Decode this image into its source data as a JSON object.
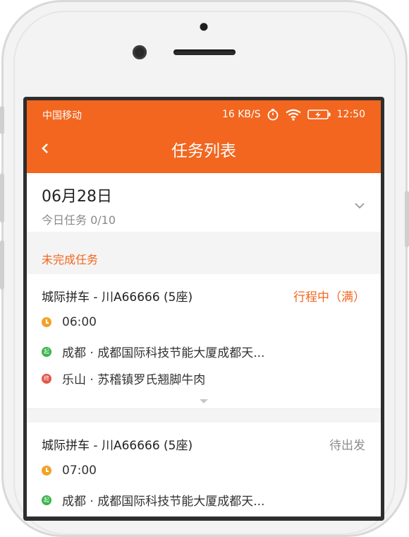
{
  "status_bar": {
    "carrier": "中国移动",
    "speed": "16 KB/S",
    "time": "12:50"
  },
  "header": {
    "title": "任务列表"
  },
  "date_panel": {
    "date": "06月28日",
    "summary": "今日任务 0/10"
  },
  "section": {
    "label": "未完成任务"
  },
  "trips": [
    {
      "title": "城际拼车 - 川A66666 (5座)",
      "status": "行程中（满）",
      "status_color": "#f2661f",
      "time": "06:00",
      "start_badge": "起",
      "start": "成都 · 成都国际科技节能大厦成都天...",
      "end_badge": "终",
      "end": "乐山 · 苏稽镇罗氏翘脚牛肉"
    },
    {
      "title": "城际拼车 - 川A66666 (5座)",
      "status": "待出发",
      "status_color": "#8e8e8e",
      "time": "07:00",
      "start_badge": "起",
      "start": "成都 · 成都国际科技节能大厦成都天..."
    }
  ]
}
